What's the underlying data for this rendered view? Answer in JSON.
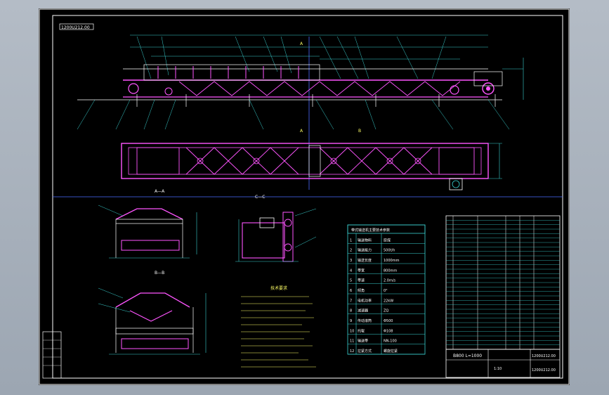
{
  "drawing": {
    "title_block": {
      "code": "1200U212.00",
      "name": "B800 L=1000",
      "number": "1200U212.00",
      "scale_label": "1:10"
    },
    "drawing_number_corner": "1200U212.00",
    "section_labels": {
      "top_right": "A—A",
      "bottom_left": "B—B",
      "drive": "C—C"
    },
    "tech_requirements_title": "技术要求",
    "param_table_title": "带式输送机主要技术参数",
    "param_rows": [
      {
        "no": "1",
        "name": "输送物料",
        "value": "原煤"
      },
      {
        "no": "2",
        "name": "输送能力",
        "value": "500t/h"
      },
      {
        "no": "3",
        "name": "输送长度",
        "value": "1000mm"
      },
      {
        "no": "4",
        "name": "带宽",
        "value": "800mm"
      },
      {
        "no": "5",
        "name": "带速",
        "value": "2.0m/s"
      },
      {
        "no": "6",
        "name": "倾角",
        "value": "0°"
      },
      {
        "no": "7",
        "name": "电机功率",
        "value": "22kW"
      },
      {
        "no": "8",
        "name": "减速器",
        "value": "ZQ"
      },
      {
        "no": "9",
        "name": "传动滚筒",
        "value": "Φ500"
      },
      {
        "no": "10",
        "name": "托辊",
        "value": "Φ108"
      },
      {
        "no": "11",
        "name": "输送带",
        "value": "NN-100"
      },
      {
        "no": "12",
        "name": "拉紧方式",
        "value": "螺旋拉紧"
      }
    ]
  },
  "colors": {
    "frame": "#ffffff",
    "structure": "#ff55ff",
    "dimension": "#3ad0d0",
    "centerline": "#4d6bff",
    "text": "#ffffff",
    "annotation": "#ffff66"
  }
}
